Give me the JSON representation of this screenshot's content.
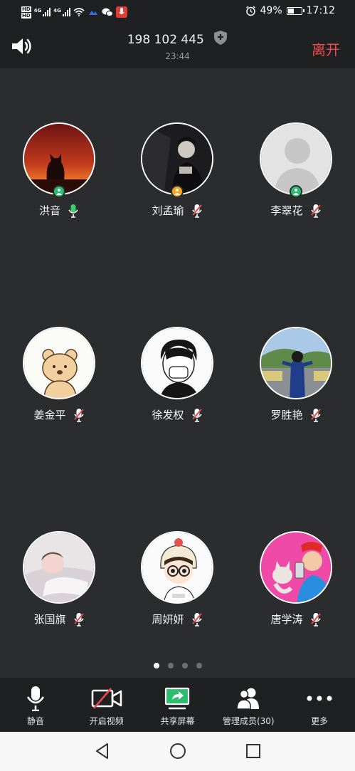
{
  "status_bar": {
    "hd_labels": [
      "HD",
      "HD"
    ],
    "network_1": "4G",
    "network_2": "4G",
    "battery_percent": "49%",
    "battery_level": 0.49,
    "time": "17:12"
  },
  "header": {
    "meeting_id": "198 102 445",
    "duration": "23:44",
    "leave_label": "离开"
  },
  "participants": [
    {
      "name": "洪音",
      "mic": "on",
      "role_color": "#2bbd6e"
    },
    {
      "name": "刘孟瑜",
      "mic": "off",
      "role_color": "#f5a623"
    },
    {
      "name": "李翠花",
      "mic": "off",
      "role_color": "#2bbd6e"
    },
    {
      "name": "姜金平",
      "mic": "off"
    },
    {
      "name": "徐发权",
      "mic": "off"
    },
    {
      "name": "罗胜艳",
      "mic": "off"
    },
    {
      "name": "张国旗",
      "mic": "off"
    },
    {
      "name": "周妍妍",
      "mic": "off"
    },
    {
      "name": "唐学涛",
      "mic": "off"
    }
  ],
  "pager": {
    "pages": 4,
    "current": 1
  },
  "toolbar": {
    "mute_label": "静音",
    "video_label": "开启视频",
    "share_label": "共享屏幕",
    "members_label": "管理成员(30)",
    "more_label": "更多"
  },
  "colors": {
    "accent_green": "#2bbd6e",
    "leave_red": "#f04b4b",
    "mic_off_red": "#e5484d"
  }
}
